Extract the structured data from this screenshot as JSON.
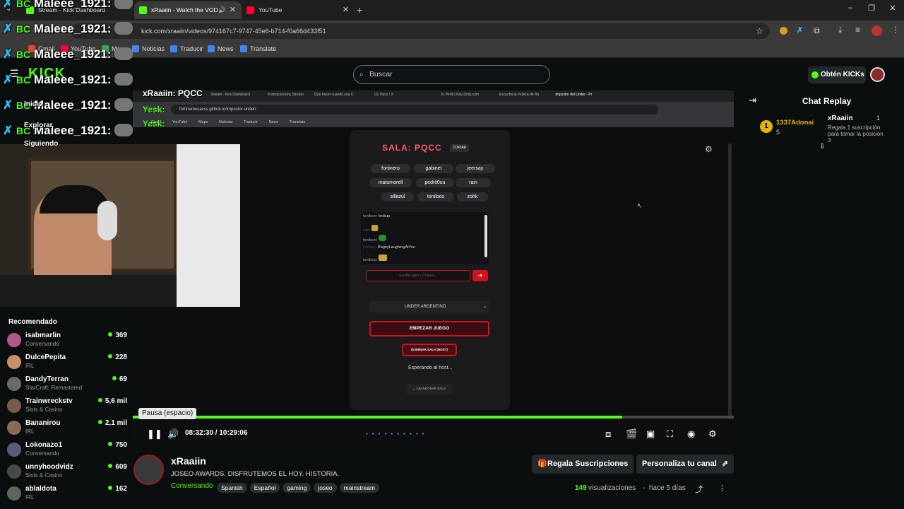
{
  "browser": {
    "tabs": [
      {
        "label": "Stream - Kick Dashboard"
      },
      {
        "label": "xRaaiin - Watch the VOD o"
      },
      {
        "label": "YouTube"
      }
    ],
    "url": "kick.com/xraaiin/videos/974167c7-9747-45e6-b714-f0a66d433f51",
    "bookmarks": [
      "Gmail",
      "YouTube",
      "Maps",
      "Noticias",
      "Traducir",
      "News",
      "Translate"
    ]
  },
  "overlay": {
    "spam_name": "Maleee_1921:",
    "spam_prefix": "BC",
    "channel_title": "xRaaiin: PQCC",
    "chat_word": "Yesk:",
    "kick_logo": "KICK",
    "sidebar_labels": [
      "Inicio",
      "Explorar",
      "Siguiendo"
    ]
  },
  "kick": {
    "search_placeholder": "Buscar",
    "get_kicks": "Obtén KICKs",
    "chat_replay_title": "Chat Replay",
    "chat_event": {
      "gifter": "1337Adonai",
      "gifter_count": "5",
      "streamer": "xRaaiin",
      "streamer_count": "1",
      "message": "Regala 1 suscripción para tomar la posición 3"
    }
  },
  "recommended": {
    "title": "Recomendado",
    "items": [
      {
        "name": "isabmarlin",
        "category": "Conversando",
        "viewers": "369",
        "color": "#b05a8a"
      },
      {
        "name": "DulcePepita",
        "category": "IRL",
        "viewers": "228",
        "color": "#c98f6b"
      },
      {
        "name": "DandyTerran",
        "category": "StarCraft: Remastered",
        "viewers": "69",
        "color": "#6a6a6a"
      },
      {
        "name": "Trainwreckstv",
        "category": "Slots & Casino",
        "viewers": "5,6 mil",
        "color": "#7a5a4a"
      },
      {
        "name": "Bananirou",
        "category": "IRL",
        "viewers": "2,1 mil",
        "color": "#8a6a5a"
      },
      {
        "name": "Lokonazo1",
        "category": "Conversando",
        "viewers": "750",
        "color": "#5a5a7a"
      },
      {
        "name": "unnyhoodvidz",
        "category": "Slots & Casino",
        "viewers": "609",
        "color": "#4a4a4a"
      },
      {
        "name": "ablaldota",
        "category": "IRL",
        "viewers": "162",
        "color": "#5a6a5a"
      }
    ]
  },
  "inner": {
    "tabs": [
      "Stream - Kick Dashboard",
      "FrancisJeremy Stream",
      "Que hacer cuando una C",
      "(3) Inicio / X",
      "Tu Perfil | Key-Drop.com",
      "Escucha la música de Ra",
      "Impostor del Under - Pr"
    ],
    "url": "fortineroocavss.github.io/impostor-under/",
    "bookmarks": [
      "Gmail",
      "YouTube",
      "Maps",
      "Noticias",
      "Traducir",
      "News",
      "Translate"
    ],
    "room_title": "SALA: PQCC",
    "copy_label": "COPIAR",
    "players": [
      "fortinero",
      "gabinet",
      "jeersay",
      "matumorell",
      "pedrit0uu",
      "rain",
      "sillazul",
      "toniloco",
      "zohk"
    ],
    "chat": [
      {
        "user": "toniloco:",
        "text": "lookup"
      },
      {
        "user": "rain:",
        "text": ""
      },
      {
        "user": "toniloco:",
        "text": ""
      },
      {
        "user": "jeersay:",
        "text": "RageyLaughingAtYou"
      },
      {
        "user": "toniloco:",
        "text": ""
      }
    ],
    "chat_placeholder": "Escribe aquí y Chatea...",
    "mode_select": "UNDER ARGENTINO",
    "start_button": "EMPEZAR JUEGO",
    "delete_button": "ELIMINAR SALA (HOST)",
    "waiting_text": "Esperando al host...",
    "leave_button": "← ABANDONAR SALA"
  },
  "player": {
    "tooltip": "Pausa (espacio)",
    "time_current": "08:32:30",
    "time_total": "10:29:06",
    "progress": 0.814
  },
  "video_info": {
    "channel": "xRaaiin",
    "title": "JOSEO AWARDS. DISFRUTEMOS EL HOY. HISTORIA.",
    "category": "Conversando",
    "tags": [
      "Spanish",
      "Español",
      "gaming",
      "joseo",
      "mainstream"
    ],
    "views_count": "149",
    "views_label": "visualizaciones",
    "age": "hace 5 días",
    "gift_button": "Regala Suscripciones",
    "customize_button": "Personaliza tu canal"
  },
  "colors": {
    "kick_green": "#53fc18",
    "red": "#d1121f",
    "bg": "#0b0e0f"
  }
}
